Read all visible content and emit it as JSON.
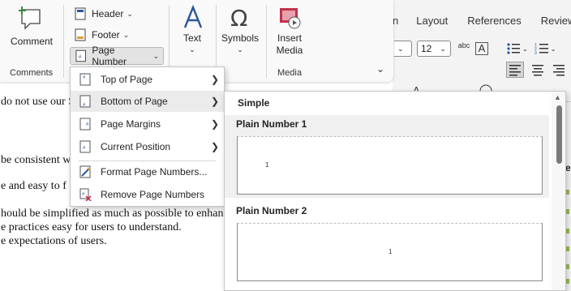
{
  "document": {
    "lines": [
      {
        "text": "do not use our S"
      },
      {
        "text": "be consistent w"
      },
      {
        "text": "e and easy to f"
      },
      {
        "text": "hould be simplified as much as possible to enhan"
      },
      {
        "text": "e practices easy for users to understand."
      },
      {
        "text": "e expectations of users."
      }
    ]
  },
  "background_ribbon": {
    "tabs": [
      "n",
      "Layout",
      "References",
      "Review"
    ],
    "font_size": "12",
    "style_icon": "abc",
    "letter_icon": "A"
  },
  "ribbon": {
    "comment": {
      "label": "Comment",
      "group": "Comments",
      "icon": "comment-icon"
    },
    "header_label": "Header",
    "footer_label": "Footer",
    "page_number_label": "Page Number",
    "text_label": "Text",
    "symbols_label": "Symbols",
    "insert_media_label": "Insert\nMedia",
    "media_group": "Media"
  },
  "menu": {
    "items": [
      {
        "label": "Top of Page",
        "has_submenu": true,
        "icon": "page-top-icon"
      },
      {
        "label": "Bottom of Page",
        "has_submenu": true,
        "icon": "page-bottom-icon"
      },
      {
        "label": "Page Margins",
        "has_submenu": true,
        "icon": "page-margins-icon"
      },
      {
        "label": "Current Position",
        "has_submenu": true,
        "icon": "current-position-icon"
      },
      {
        "label": "Format Page Numbers...",
        "has_submenu": false,
        "icon": "format-page-numbers-icon"
      },
      {
        "label": "Remove Page Numbers",
        "has_submenu": false,
        "icon": "remove-page-numbers-icon"
      }
    ],
    "highlighted": "Bottom of Page"
  },
  "gallery": {
    "section": "Simple",
    "items": [
      {
        "title": "Plain Number 1",
        "number": "1",
        "align": "left"
      },
      {
        "title": "Plain Number 2",
        "number": "1",
        "align": "center"
      }
    ]
  },
  "colors": {
    "accent_blue": "#2b579a",
    "media_red": "#c4314b",
    "hover_bg": "#ebebeb"
  }
}
